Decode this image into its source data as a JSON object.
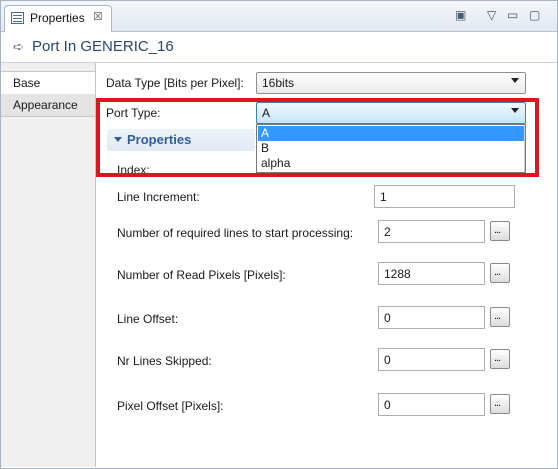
{
  "view_tab": {
    "label": "Properties",
    "close": "☒"
  },
  "toolbar": {
    "new_icon": "▣",
    "menu_icon": "▽",
    "minimize_icon": "▭",
    "maximize_icon": "▢"
  },
  "title": {
    "arrow_icon": "➪",
    "text": "Port In GENERIC_16"
  },
  "sidebar": {
    "items": [
      {
        "label": "Base"
      },
      {
        "label": "Appearance"
      }
    ]
  },
  "data_type": {
    "label": "Data Type [Bits per Pixel]:",
    "value": "16bits"
  },
  "port_type": {
    "label": "Port Type:",
    "value": "A",
    "options": [
      "A",
      "B",
      "alpha"
    ],
    "selected": "A"
  },
  "properties_section": {
    "label": "Properties"
  },
  "fields": {
    "index": {
      "label": "Index:"
    },
    "line_increment": {
      "label": "Line Increment:",
      "value": "1"
    },
    "required_lines": {
      "label": "Number of required lines to start processing:",
      "value": "2",
      "button": "..."
    },
    "read_pixels": {
      "label": "Number of Read Pixels [Pixels]:",
      "value": "1288",
      "button": "..."
    },
    "line_offset": {
      "label": "Line Offset:",
      "value": "0",
      "button": "..."
    },
    "lines_skipped": {
      "label": "Nr Lines Skipped:",
      "value": "0",
      "button": "..."
    },
    "pixel_offset": {
      "label": "Pixel Offset [Pixels]:",
      "value": "0",
      "button": "..."
    }
  },
  "colors": {
    "highlight_box": "#e0141f",
    "selection": "#3399ff",
    "section_title": "#2f5f9a"
  }
}
